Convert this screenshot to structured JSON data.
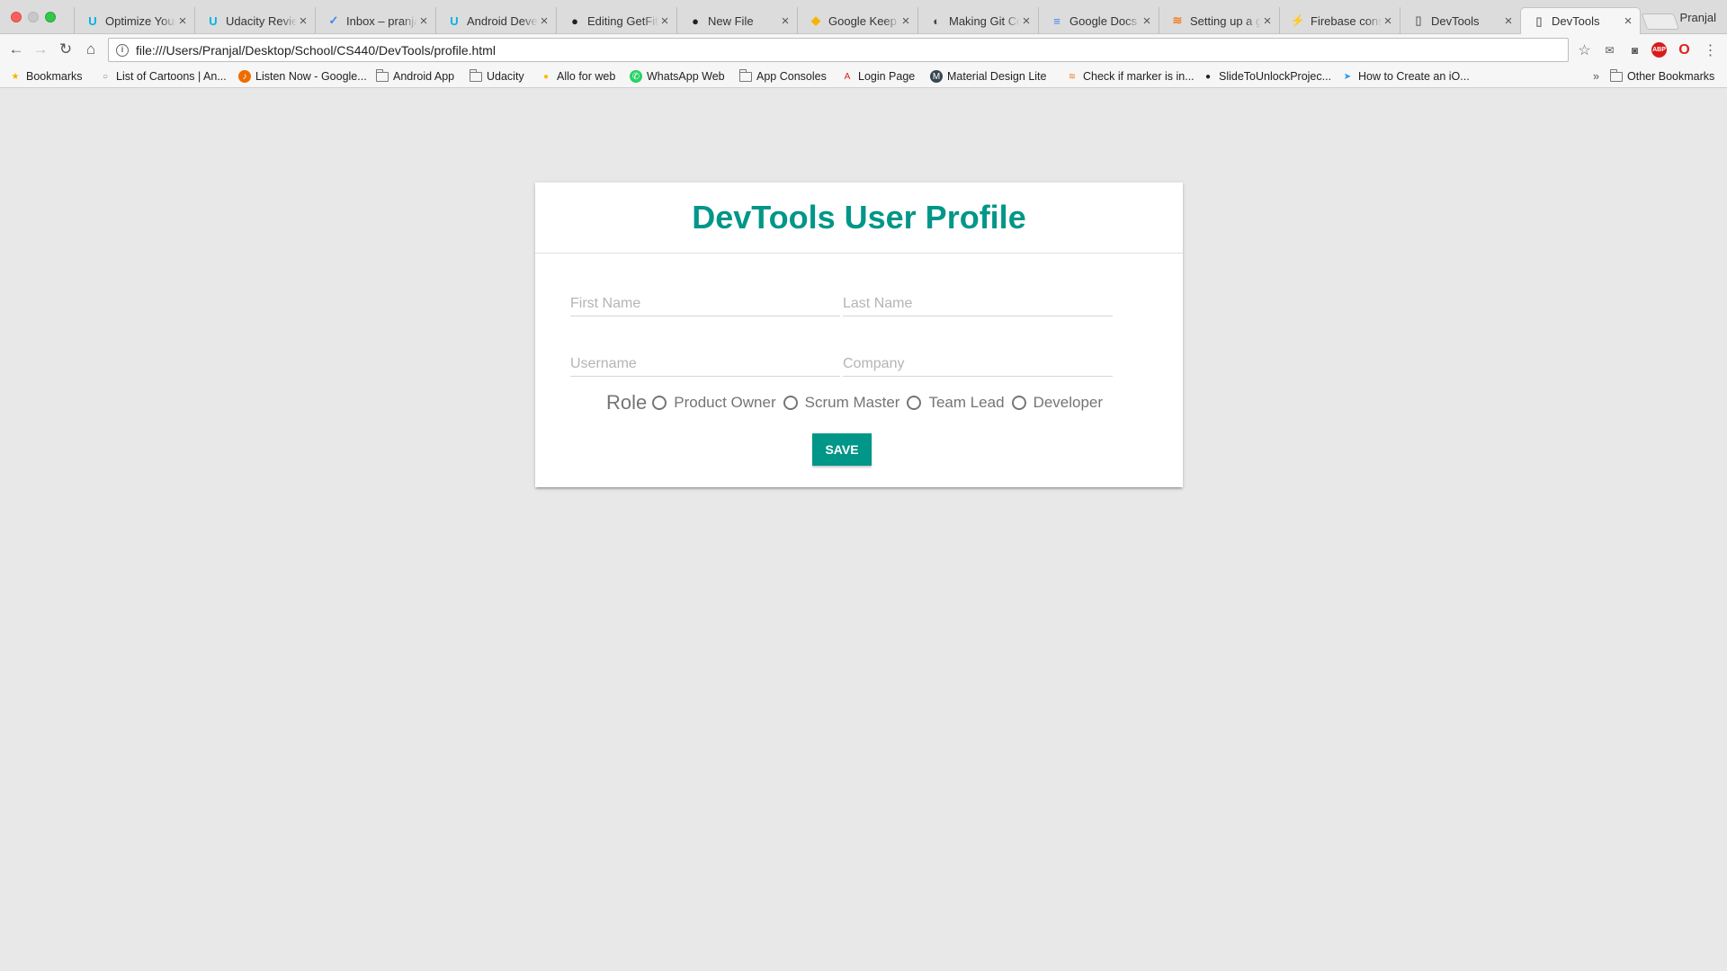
{
  "browser": {
    "tabs": [
      {
        "title": "Optimize Your",
        "icon": "udacity-icon",
        "fav": "U",
        "color": "#02b3e4"
      },
      {
        "title": "Udacity Review",
        "icon": "udacity-icon",
        "fav": "U",
        "color": "#02b3e4"
      },
      {
        "title": "Inbox – pranjal",
        "icon": "inbox-icon",
        "fav": "✓",
        "color": "#4285f4"
      },
      {
        "title": "Android Devel",
        "icon": "udacity-icon",
        "fav": "U",
        "color": "#02b3e4"
      },
      {
        "title": "Editing GetFit",
        "icon": "github-icon",
        "fav": "●",
        "color": "#222222"
      },
      {
        "title": "New File",
        "icon": "github-icon",
        "fav": "●",
        "color": "#222222"
      },
      {
        "title": "Google Keep",
        "icon": "keep-icon",
        "fav": "◆",
        "color": "#f6b400"
      },
      {
        "title": "Making Git Co",
        "icon": "git-icon",
        "fav": "◐",
        "color": "#444444"
      },
      {
        "title": "Google Docs",
        "icon": "docs-icon",
        "fav": "≡",
        "color": "#4285f4"
      },
      {
        "title": "Setting up a g",
        "icon": "stackoverflow-icon",
        "fav": "≋",
        "color": "#f48024"
      },
      {
        "title": "Firebase cons",
        "icon": "firebase-icon",
        "fav": "⚡",
        "color": "#f5a623"
      },
      {
        "title": "DevTools",
        "icon": "page-icon",
        "fav": "▯",
        "color": "#777777"
      },
      {
        "title": "DevTools",
        "icon": "page-icon",
        "fav": "▯",
        "color": "#777777",
        "active": true
      }
    ],
    "profile_name": "Pranjal",
    "url": "file:///Users/Pranjal/Desktop/School/CS440/DevTools/profile.html",
    "bookmarks": [
      {
        "label": "Bookmarks",
        "icon": "star-icon"
      },
      {
        "label": "List of Cartoons | An...",
        "icon": "globe-icon"
      },
      {
        "label": "Listen Now - Google...",
        "icon": "play-music-icon"
      },
      {
        "label": "Android App",
        "icon": "folder-icon"
      },
      {
        "label": "Udacity",
        "icon": "folder-icon"
      },
      {
        "label": "Allo for web",
        "icon": "allo-icon"
      },
      {
        "label": "WhatsApp Web",
        "icon": "whatsapp-icon"
      },
      {
        "label": "App Consoles",
        "icon": "folder-icon"
      },
      {
        "label": "Login Page",
        "icon": "angular-icon"
      },
      {
        "label": "Material Design Lite",
        "icon": "mdl-icon"
      },
      {
        "label": "Check if marker is in...",
        "icon": "stackoverflow-icon"
      },
      {
        "label": "SlideToUnlockProjec...",
        "icon": "github-icon"
      },
      {
        "label": "How to Create an iO...",
        "icon": "swift-icon"
      }
    ],
    "overflow_label": "»",
    "other_bookmarks": "Other Bookmarks"
  },
  "page": {
    "title": "DevTools User Profile",
    "first_name_placeholder": "First Name",
    "last_name_placeholder": "Last Name",
    "username_placeholder": "Username",
    "company_placeholder": "Company",
    "role_label": "Role",
    "roles": [
      "Product Owner",
      "Scrum Master",
      "Team Lead",
      "Developer"
    ],
    "save_label": "SAVE",
    "accent_color": "#009688"
  }
}
